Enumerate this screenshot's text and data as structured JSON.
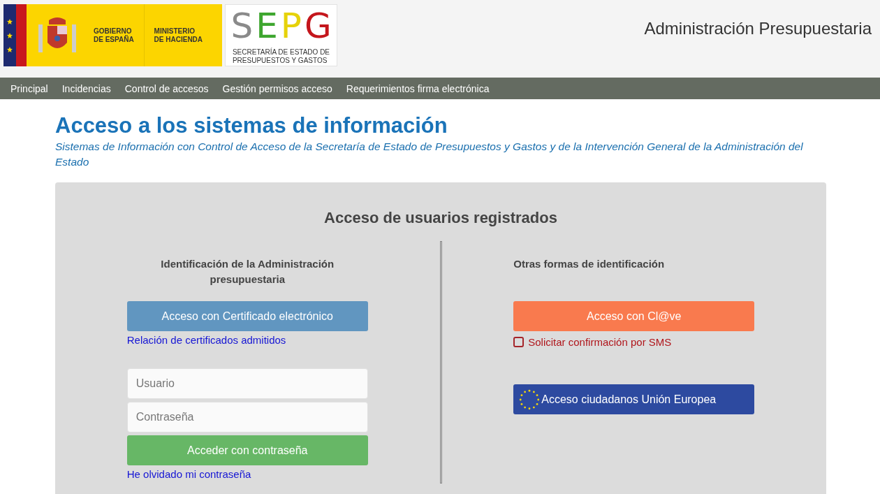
{
  "header": {
    "government_logo": {
      "line1": "GOBIERNO",
      "line2": "DE ESPAÑA",
      "ministry1": "MINISTERIO",
      "ministry2": "DE HACIENDA"
    },
    "agency_logo": {
      "letters": [
        {
          "text": "S",
          "color": "#8a8a8a"
        },
        {
          "text": "E",
          "color": "#3ea62f"
        },
        {
          "text": "P",
          "color": "#e6d20a"
        },
        {
          "text": "G",
          "color": "#c4161c"
        }
      ],
      "line1": "SECRETARÍA DE ESTADO DE",
      "line2": "PRESUPUESTOS Y GASTOS"
    },
    "site_title": "Administración Presupuestaria"
  },
  "nav": [
    "Principal",
    "Incidencias",
    "Control de accesos",
    "Gestión permisos acceso",
    "Requerimientos firma electrónica"
  ],
  "page": {
    "title": "Acceso a los sistemas de información",
    "subtitle": "Sistemas de Información con Control de Acceso de la Secretaría de Estado de Presupuestos y Gastos y de la Intervención General de la Administración del Estado"
  },
  "panel": {
    "heading": "Acceso de usuarios registrados",
    "left": {
      "heading": "Identificación de la Administración presupuestaria",
      "certificate_button": "Acceso con Certificado electrónico",
      "certificates_link": "Relación de certificados admitidos",
      "username": {
        "placeholder": "Usuario"
      },
      "password": {
        "placeholder": "Contraseña"
      },
      "login_button": "Acceder con contraseña",
      "forgot_link": "He olvidado mi contraseña"
    },
    "right": {
      "heading": "Otras formas de identificación",
      "clave_button": "Acceso con Cl@ve",
      "sms": {
        "label": "Solicitar confirmación por SMS",
        "checked": false
      },
      "eu_button": "Acceso ciudadanos Unión Europea"
    }
  }
}
